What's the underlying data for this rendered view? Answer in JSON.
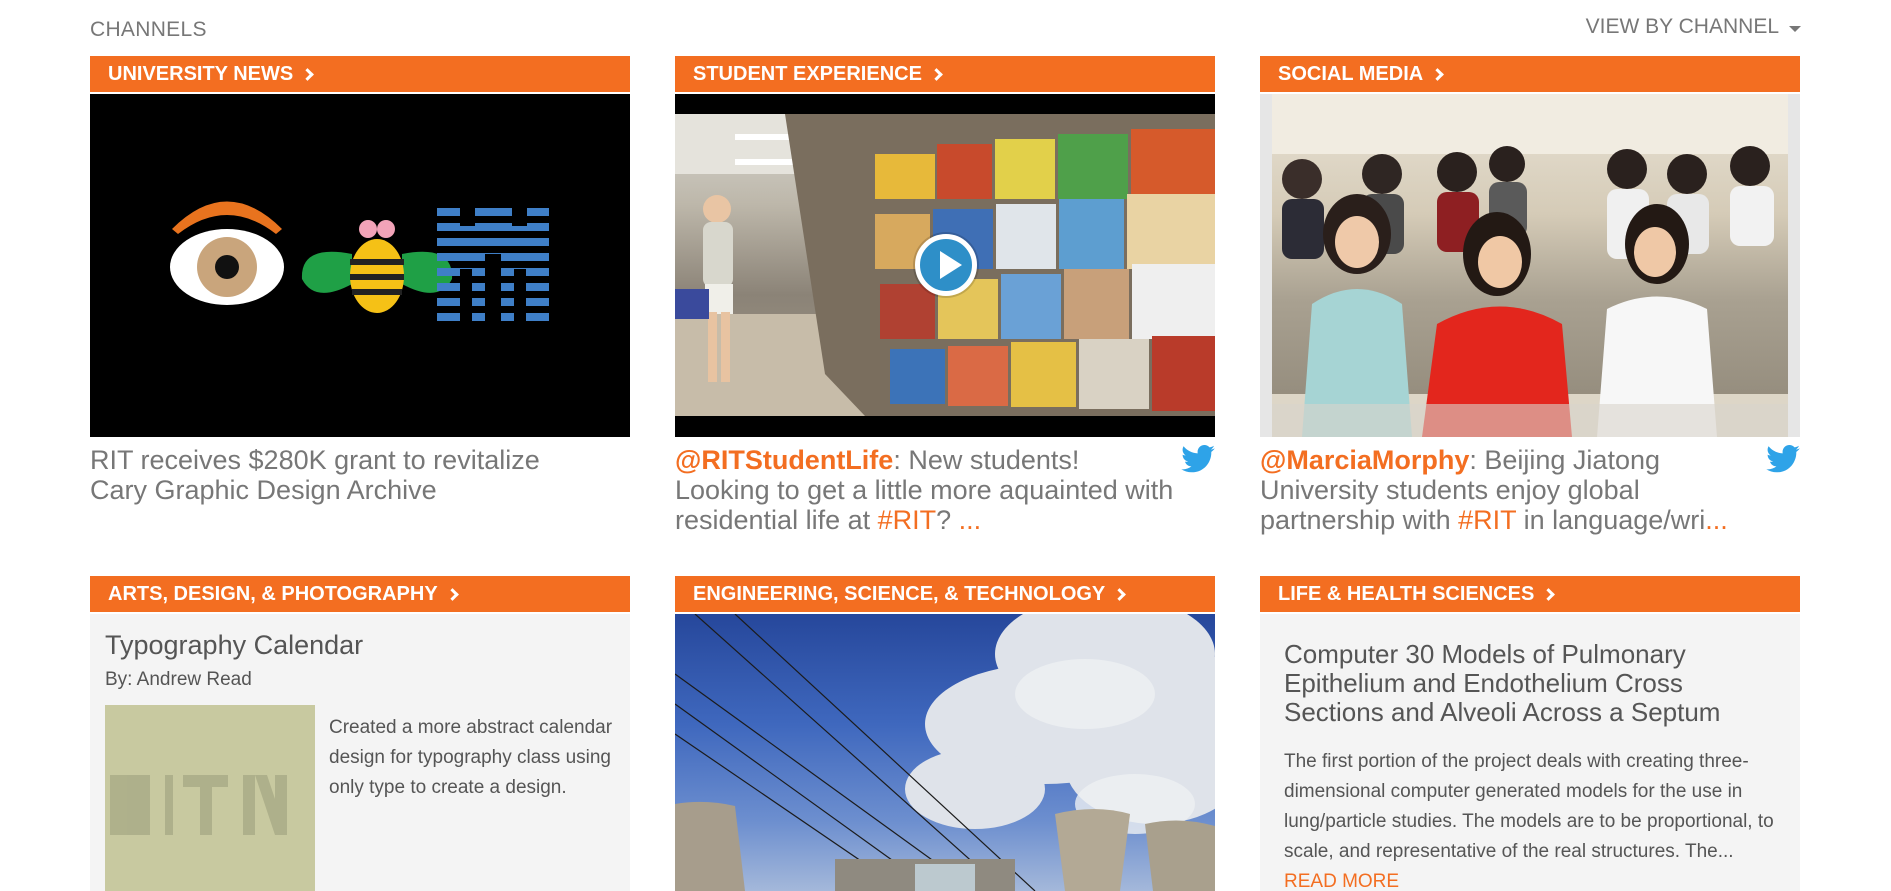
{
  "header": {
    "title": "CHANNELS",
    "view_by": "VIEW BY CHANNEL"
  },
  "cards": [
    {
      "label": "UNIVERSITY NEWS",
      "caption": "RIT receives $280K grant to revitalize Cary Graphic Design Archive"
    },
    {
      "label": "STUDENT EXPERIENCE",
      "handle": "@RITStudentLife",
      "text": ": New students! Looking to get a little more aquainted with residential life at ",
      "tag": "#RIT",
      "after_tag": "? ",
      "more": "..."
    },
    {
      "label": "SOCIAL MEDIA",
      "handle": "@MarciaMorphy",
      "text": ": Beijing Jiatong University students enjoy global partnership with ",
      "tag": "#RIT",
      "after_tag": " in language/wri",
      "more": "..."
    },
    {
      "label": "ARTS, DESIGN, & PHOTOGRAPHY",
      "title": "Typography Calendar",
      "author": "By: Andrew Read",
      "description": "Created a more abstract calendar design for typography class using only type to create a design."
    },
    {
      "label": "ENGINEERING, SCIENCE, & TECHNOLOGY"
    },
    {
      "label": "LIFE & HEALTH SCIENCES",
      "title": "Computer 30 Models of Pulmonary Epithelium and Endothelium Cross Sections and Alveoli Across a Septum",
      "description": "The first portion of the project deals with creating three-dimensional computer generated models for the use in lung/particle studies. The models are to be proportional, to scale, and representative of the real structures. The...",
      "read_more": " READ MORE"
    }
  ],
  "colors": {
    "accent": "#f36e21",
    "twitter": "#2ea3e8",
    "play": "#2e8fc8"
  },
  "icons": [
    "chevron-right-icon",
    "caret-down-icon",
    "twitter-bird-icon",
    "play-icon"
  ]
}
